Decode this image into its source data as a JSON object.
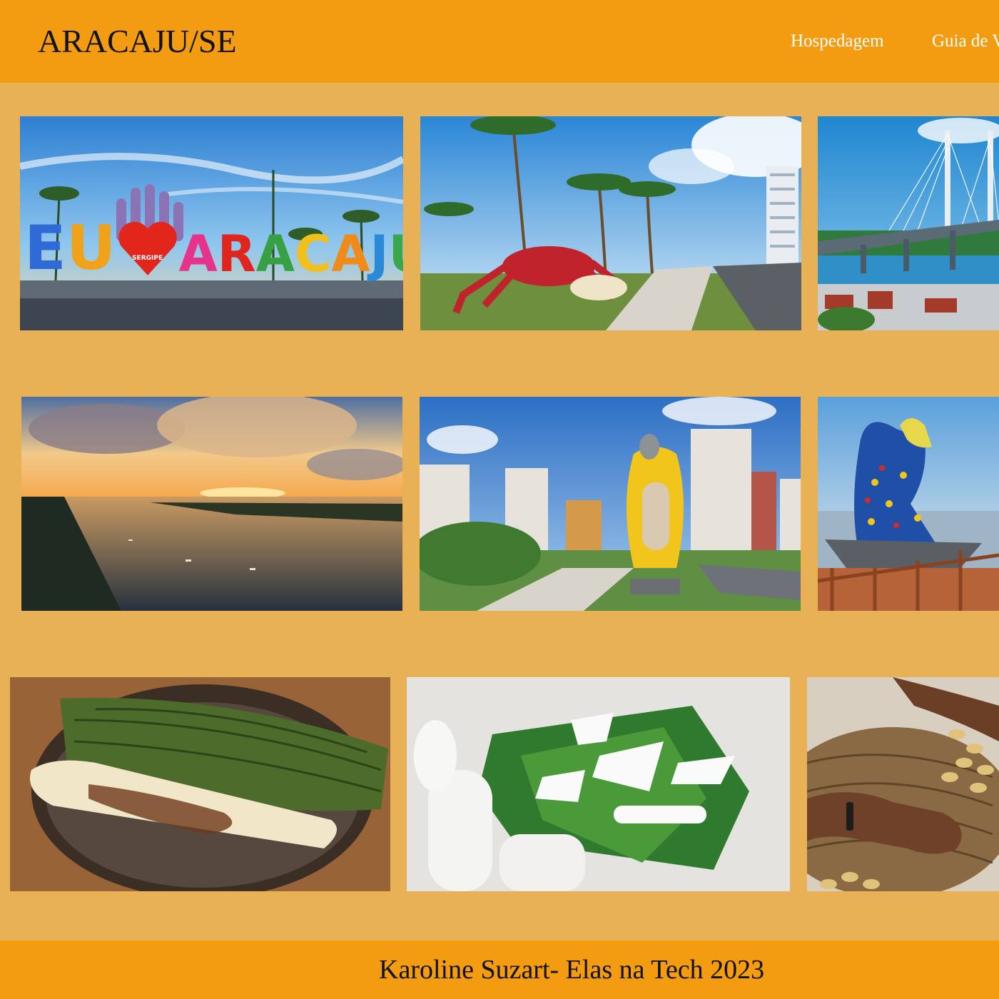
{
  "header": {
    "title": "ARACAJU/SE",
    "nav": [
      {
        "label": "Hospedagem"
      },
      {
        "label": "Guia de Viagem"
      }
    ]
  },
  "gallery": {
    "sign_letters": [
      "E",
      "U",
      "A",
      "R",
      "A",
      "C",
      "A",
      "J",
      "U"
    ],
    "sign_heart_text": "SERGIPE"
  },
  "footer": {
    "text": "Karoline Suzart- Elas na Tech 2023"
  },
  "colors": {
    "header_bg": "#f39c12",
    "page_bg": "#e8b155",
    "nav_text": "#ffffff"
  }
}
